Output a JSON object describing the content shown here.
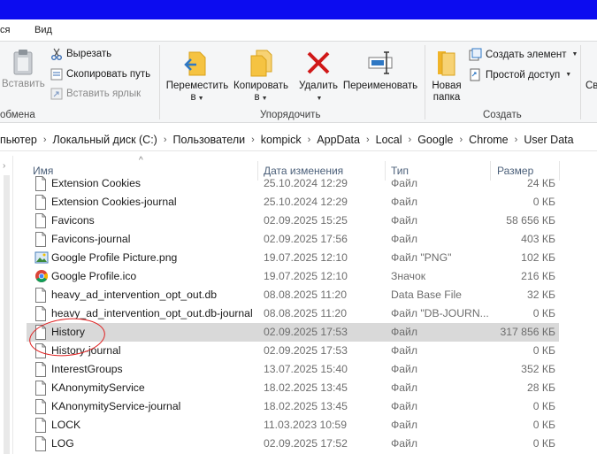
{
  "menu": {
    "partial_left": "ся",
    "view": "Вид"
  },
  "ribbon": {
    "paste_label": "Вставить",
    "cut_label": "Вырезать",
    "copy_path_label": "Скопировать путь",
    "paste_shortcut_label": "Вставить ярлык",
    "move_label_1": "Переместить",
    "move_label_2": "в",
    "copy_label_1": "Копировать",
    "copy_label_2": "в",
    "delete_label": "Удалить",
    "rename_label": "Переименовать",
    "new_folder_label_1": "Новая",
    "new_folder_label_2": "папка",
    "new_item_label": "Создать элемент",
    "easy_access_label": "Простой доступ",
    "partial_right": "Св",
    "group_clipboard": "обмена",
    "group_organize": "Упорядочить",
    "group_new": "Создать"
  },
  "breadcrumb": [
    "пьютер",
    "Локальный диск (C:)",
    "Пользователи",
    "kompick",
    "AppData",
    "Local",
    "Google",
    "Chrome",
    "User Data"
  ],
  "columns": {
    "name": "Имя",
    "date": "Дата изменения",
    "type": "Тип",
    "size": "Размер"
  },
  "files": [
    {
      "name": "Extension Cookies",
      "date": "25.10.2024 12:29",
      "type": "Файл",
      "size": "24 КБ",
      "icon": "file-icon"
    },
    {
      "name": "Extension Cookies-journal",
      "date": "25.10.2024 12:29",
      "type": "Файл",
      "size": "0 КБ",
      "icon": "file-icon"
    },
    {
      "name": "Favicons",
      "date": "02.09.2025 15:25",
      "type": "Файл",
      "size": "58 656 КБ",
      "icon": "file-icon"
    },
    {
      "name": "Favicons-journal",
      "date": "02.09.2025 17:56",
      "type": "Файл",
      "size": "403 КБ",
      "icon": "file-icon"
    },
    {
      "name": "Google Profile Picture.png",
      "date": "19.07.2025 12:10",
      "type": "Файл \"PNG\"",
      "size": "102 КБ",
      "icon": "image-icon"
    },
    {
      "name": "Google Profile.ico",
      "date": "19.07.2025 12:10",
      "type": "Значок",
      "size": "216 КБ",
      "icon": "chrome-icon"
    },
    {
      "name": "heavy_ad_intervention_opt_out.db",
      "date": "08.08.2025 11:20",
      "type": "Data Base File",
      "size": "32 КБ",
      "icon": "file-icon"
    },
    {
      "name": "heavy_ad_intervention_opt_out.db-journal",
      "date": "08.08.2025 11:20",
      "type": "Файл \"DB-JOURN...",
      "size": "0 КБ",
      "icon": "file-icon"
    },
    {
      "name": "History",
      "date": "02.09.2025 17:53",
      "type": "Файл",
      "size": "317 856 КБ",
      "icon": "file-icon",
      "selected": true
    },
    {
      "name": "History-journal",
      "date": "02.09.2025 17:53",
      "type": "Файл",
      "size": "0 КБ",
      "icon": "file-icon"
    },
    {
      "name": "InterestGroups",
      "date": "13.07.2025 15:40",
      "type": "Файл",
      "size": "352 КБ",
      "icon": "file-icon"
    },
    {
      "name": "KAnonymityService",
      "date": "18.02.2025 13:45",
      "type": "Файл",
      "size": "28 КБ",
      "icon": "file-icon"
    },
    {
      "name": "KAnonymityService-journal",
      "date": "18.02.2025 13:45",
      "type": "Файл",
      "size": "0 КБ",
      "icon": "file-icon"
    },
    {
      "name": "LOCK",
      "date": "11.03.2023 10:59",
      "type": "Файл",
      "size": "0 КБ",
      "icon": "file-icon"
    },
    {
      "name": "LOG",
      "date": "02.09.2025 17:52",
      "type": "Файл",
      "size": "0 КБ",
      "icon": "file-icon"
    }
  ],
  "colors": {
    "titlebar": "#0c0cf0",
    "annotation": "#e02020",
    "selection": "#d9d9d9",
    "header_text": "#4c607a"
  }
}
